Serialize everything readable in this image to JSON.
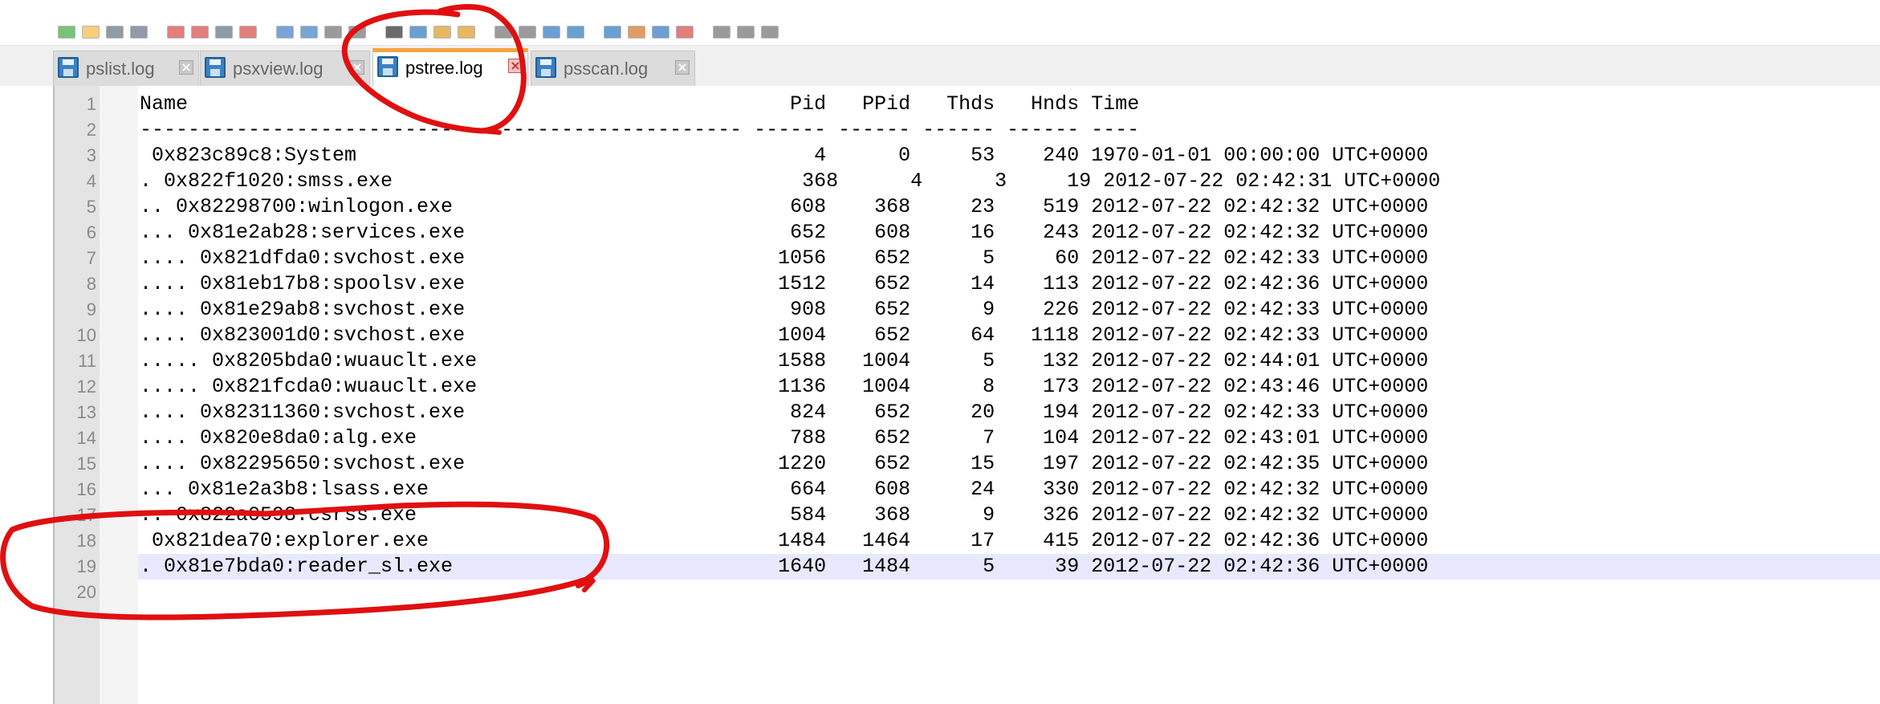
{
  "tabs": [
    {
      "label": "pslist.log",
      "active": false,
      "close_glyph": "×"
    },
    {
      "label": "psxview.log",
      "active": false,
      "close_glyph": "×"
    },
    {
      "label": "pstree.log",
      "active": true,
      "close_glyph": "×"
    },
    {
      "label": "psscan.log",
      "active": false,
      "close_glyph": "×"
    }
  ],
  "toolbar_icons": [
    "new-file-icon",
    "open-file-icon",
    "save-icon",
    "save-all-icon",
    "close-icon",
    "close-all-icon",
    "print-icon",
    "cut-icon",
    "copy-icon",
    "paste-icon",
    "undo-icon",
    "redo-icon",
    "find-icon",
    "replace-icon",
    "zoom-in-icon",
    "zoom-out-icon",
    "sync-scroll-icon",
    "word-wrap-icon",
    "show-all-chars-icon",
    "indent-guide-icon",
    "function-list-icon",
    "folder-workspace-icon",
    "monitoring-icon",
    "record-macro-icon",
    "stop-macro-icon",
    "play-macro-icon",
    "save-macro-icon"
  ],
  "editor": {
    "highlighted_line": 19,
    "lines": [
      "Name                                                  Pid   PPid   Thds   Hnds Time",
      "-------------------------------------------------- ------ ------ ------ ------ ----",
      " 0x823c89c8:System                                      4      0     53    240 1970-01-01 00:00:00 UTC+0000",
      ". 0x822f1020:smss.exe                                  368      4      3     19 2012-07-22 02:42:31 UTC+0000",
      ".. 0x82298700:winlogon.exe                            608    368     23    519 2012-07-22 02:42:32 UTC+0000",
      "... 0x81e2ab28:services.exe                           652    608     16    243 2012-07-22 02:42:32 UTC+0000",
      ".... 0x821dfda0:svchost.exe                          1056    652      5     60 2012-07-22 02:42:33 UTC+0000",
      ".... 0x81eb17b8:spoolsv.exe                          1512    652     14    113 2012-07-22 02:42:36 UTC+0000",
      ".... 0x81e29ab8:svchost.exe                           908    652      9    226 2012-07-22 02:42:33 UTC+0000",
      ".... 0x823001d0:svchost.exe                          1004    652     64   1118 2012-07-22 02:42:33 UTC+0000",
      "..... 0x8205bda0:wuauclt.exe                         1588   1004      5    132 2012-07-22 02:44:01 UTC+0000",
      "..... 0x821fcda0:wuauclt.exe                         1136   1004      8    173 2012-07-22 02:43:46 UTC+0000",
      ".... 0x82311360:svchost.exe                           824    652     20    194 2012-07-22 02:42:33 UTC+0000",
      ".... 0x820e8da0:alg.exe                               788    652      7    104 2012-07-22 02:43:01 UTC+0000",
      ".... 0x82295650:svchost.exe                          1220    652     15    197 2012-07-22 02:42:35 UTC+0000",
      "... 0x81e2a3b8:lsass.exe                              664    608     24    330 2012-07-22 02:42:32 UTC+0000",
      ".. 0x822a0598:csrss.exe                               584    368      9    326 2012-07-22 02:42:32 UTC+0000",
      " 0x821dea70:explorer.exe                             1484   1464     17    415 2012-07-22 02:42:36 UTC+0000",
      ". 0x81e7bda0:reader_sl.exe                           1640   1484      5     39 2012-07-22 02:42:36 UTC+0000",
      ""
    ]
  },
  "colors": {
    "active_tab_accent": "#f5a33e",
    "annotation_red": "#e01010",
    "current_line_highlight": "#e8e8ff"
  }
}
